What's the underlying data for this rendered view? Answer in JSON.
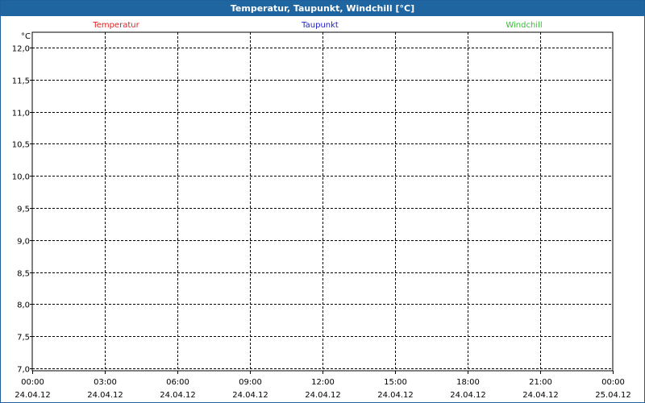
{
  "window": {
    "title": "Temperatur, Taupunkt, Windchill [°C]"
  },
  "colors": {
    "titlebar": "#1f65a0",
    "temperatur": "#e02020",
    "taupunkt": "#2020d0",
    "windchill": "#30c030"
  },
  "chart_data": {
    "type": "line",
    "title": "Temperatur, Taupunkt, Windchill [°C]",
    "ylabel": "°C",
    "xlabel": "",
    "ylim": [
      7.0,
      12.0
    ],
    "y_ticks": [
      "12,0",
      "11,5",
      "11,0",
      "10,5",
      "10,0",
      "9,5",
      "9,0",
      "8,5",
      "8,0",
      "7,5",
      "7,0"
    ],
    "x_ticks": [
      {
        "time": "00:00",
        "date": "24.04.12"
      },
      {
        "time": "03:00",
        "date": "24.04.12"
      },
      {
        "time": "06:00",
        "date": "24.04.12"
      },
      {
        "time": "09:00",
        "date": "24.04.12"
      },
      {
        "time": "12:00",
        "date": "24.04.12"
      },
      {
        "time": "15:00",
        "date": "24.04.12"
      },
      {
        "time": "18:00",
        "date": "24.04.12"
      },
      {
        "time": "21:00",
        "date": "24.04.12"
      },
      {
        "time": "00:00",
        "date": "25.04.12"
      }
    ],
    "grid": true,
    "legend_placement": "top",
    "series": [
      {
        "name": "Temperatur",
        "color": "#e02020",
        "values": []
      },
      {
        "name": "Taupunkt",
        "color": "#2020d0",
        "values": []
      },
      {
        "name": "Windchill",
        "color": "#30c030",
        "values": []
      }
    ]
  }
}
